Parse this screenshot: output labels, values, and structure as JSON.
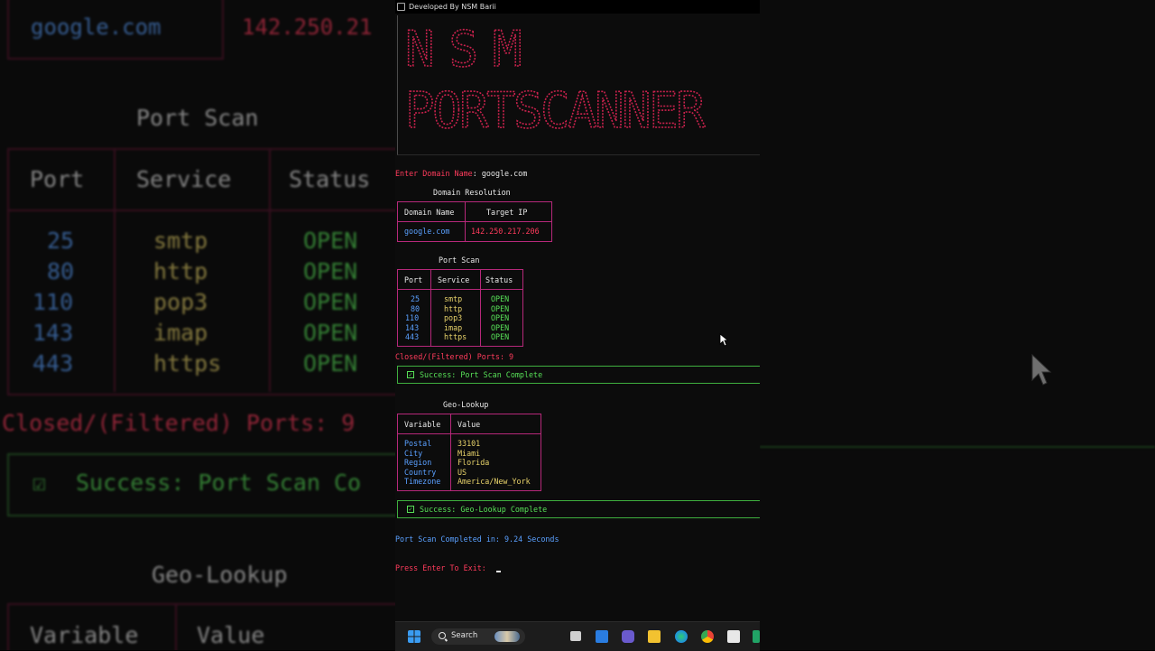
{
  "window": {
    "title": "Developed By NSM Barii"
  },
  "banner": {
    "line1": "NSM",
    "line2": "PORTSCANNER"
  },
  "prompt": {
    "label": "Enter Domain Name",
    "separator": ": ",
    "value": "google.com"
  },
  "domain_resolution": {
    "title": "Domain Resolution",
    "headers": [
      "Domain Name",
      "Target IP"
    ],
    "domain": "google.com",
    "ip": "142.250.217.206"
  },
  "port_scan": {
    "title": "Port Scan",
    "headers": [
      "Port",
      "Service",
      "Status"
    ],
    "rows": [
      {
        "port": "25",
        "service": "smtp",
        "status": "OPEN"
      },
      {
        "port": "80",
        "service": "http",
        "status": "OPEN"
      },
      {
        "port": "110",
        "service": "pop3",
        "status": "OPEN"
      },
      {
        "port": "143",
        "service": "imap",
        "status": "OPEN"
      },
      {
        "port": "443",
        "service": "https",
        "status": "OPEN"
      }
    ],
    "closed": "Closed/(Filtered) Ports: 9"
  },
  "success_port": "Success: Port Scan Complete",
  "geo": {
    "title": "Geo-Lookup",
    "headers": [
      "Variable",
      "Value"
    ],
    "rows": [
      {
        "variable": "Postal",
        "value": "33101"
      },
      {
        "variable": "City",
        "value": "Miami"
      },
      {
        "variable": "Region",
        "value": "Florida"
      },
      {
        "variable": "Country",
        "value": "US"
      },
      {
        "variable": "Timezone",
        "value": "America/New_York"
      }
    ]
  },
  "success_geo": "Success: Geo-Lookup Complete",
  "completed": "Port Scan Completed in: 9.24 Seconds",
  "exit_prompt": "Press Enter To Exit:",
  "taskbar": {
    "search_label": "Search"
  },
  "backdrop": {
    "domain": "google.com",
    "ip": "142.250.21",
    "port_scan_title": "Port Scan",
    "headers": [
      "Port",
      "Service",
      "Status"
    ],
    "ports": [
      "25",
      "80",
      "110",
      "143",
      "443"
    ],
    "services": [
      "smtp",
      "http",
      "pop3",
      "imap",
      "https"
    ],
    "statuses": [
      "OPEN",
      "OPEN",
      "OPEN",
      "OPEN",
      "OPEN"
    ],
    "closed": "Closed/(Filtered) Ports: 9",
    "success": "Success: Port Scan Co",
    "geo_title": "Geo-Lookup",
    "geo_headers": [
      "Variable",
      "Value"
    ]
  },
  "colors": {
    "accent_red": "#ff3b5c",
    "accent_green": "#57e057",
    "accent_blue": "#5aa0ff",
    "border_pink": "#b6287a"
  }
}
